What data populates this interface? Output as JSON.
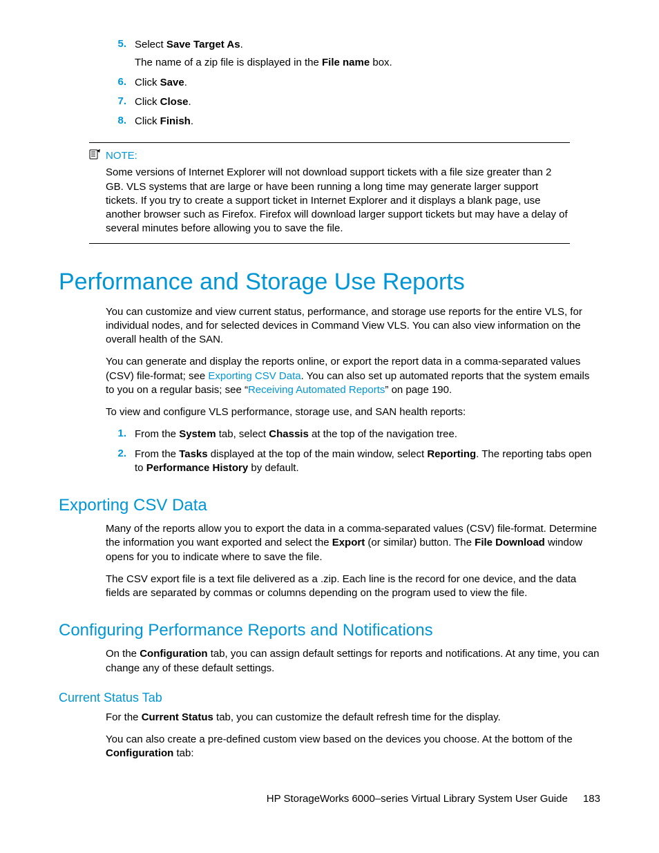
{
  "steps_top": [
    {
      "num": "5.",
      "pre": "Select ",
      "bold": "Save Target As",
      "post": ".",
      "sub_pre": "The name of a zip file is displayed in the ",
      "sub_bold": "File name",
      "sub_post": " box."
    },
    {
      "num": "6.",
      "pre": "Click ",
      "bold": "Save",
      "post": "."
    },
    {
      "num": "7.",
      "pre": "Click ",
      "bold": "Close",
      "post": "."
    },
    {
      "num": "8.",
      "pre": "Click ",
      "bold": "Finish",
      "post": "."
    }
  ],
  "note": {
    "label": "NOTE:",
    "body": "Some versions of Internet Explorer will not download support tickets with a file size greater than 2 GB. VLS systems that are large or have been running a long time may generate larger support tickets. If you try to create a support ticket in Internet Explorer and it displays a blank page, use another browser such as Firefox. Firefox will download larger support tickets but may have a delay of several minutes before allowing you to save the file."
  },
  "h1": "Performance and Storage Use Reports",
  "p1": "You can customize and view current status, performance, and storage use reports for the entire VLS, for individual nodes, and for selected devices in Command View VLS. You can also view information on the overall health of the SAN.",
  "p2_pre": "You can generate and display the reports online, or export the report data in a comma-separated values (CSV) file-format; see ",
  "p2_link1": "Exporting CSV Data",
  "p2_mid": ". You can also set up automated reports that the system emails to you on a regular basis; see “",
  "p2_link2": "Receiving Automated Reports",
  "p2_post": "” on page 190.",
  "p3": "To view and configure VLS performance, storage use, and SAN health reports:",
  "steps_mid": [
    {
      "num": "1.",
      "parts": [
        {
          "t": "From the "
        },
        {
          "b": "System"
        },
        {
          "t": " tab, select "
        },
        {
          "b": "Chassis"
        },
        {
          "t": " at the top of the navigation tree."
        }
      ]
    },
    {
      "num": "2.",
      "parts": [
        {
          "t": "From the "
        },
        {
          "b": "Tasks"
        },
        {
          "t": " displayed at the top of the main window, select "
        },
        {
          "b": "Reporting"
        },
        {
          "t": ". The reporting tabs open to "
        },
        {
          "b": "Performance History"
        },
        {
          "t": " by default."
        }
      ]
    }
  ],
  "h2a": "Exporting CSV Data",
  "csv_p1_parts": [
    {
      "t": "Many of the reports allow you to export the data in a comma-separated values (CSV) file-format. Determine the information you want exported and select the "
    },
    {
      "b": "Export"
    },
    {
      "t": " (or similar) button. The "
    },
    {
      "b": "File Download"
    },
    {
      "t": " window opens for you to indicate where to save the file."
    }
  ],
  "csv_p2": "The CSV export file is a text file delivered as a .zip. Each line is the record for one device, and the data fields are separated by commas or columns depending on the program used to view the file.",
  "h2b": "Configuring Performance Reports and Notifications",
  "cfg_p1_parts": [
    {
      "t": "On the "
    },
    {
      "b": "Configuration"
    },
    {
      "t": " tab, you can assign default settings for reports and notifications. At any time, you can change any of these default settings."
    }
  ],
  "h3": "Current Status Tab",
  "cst_p1_parts": [
    {
      "t": "For the "
    },
    {
      "b": "Current Status"
    },
    {
      "t": " tab, you can customize the default refresh time for the display."
    }
  ],
  "cst_p2_parts": [
    {
      "t": "You can also create a pre-defined custom view based on the devices you choose. At the bottom of the "
    },
    {
      "b": "Configuration"
    },
    {
      "t": " tab:"
    }
  ],
  "footer": {
    "title": "HP StorageWorks 6000–series Virtual Library System User Guide",
    "page": "183"
  }
}
